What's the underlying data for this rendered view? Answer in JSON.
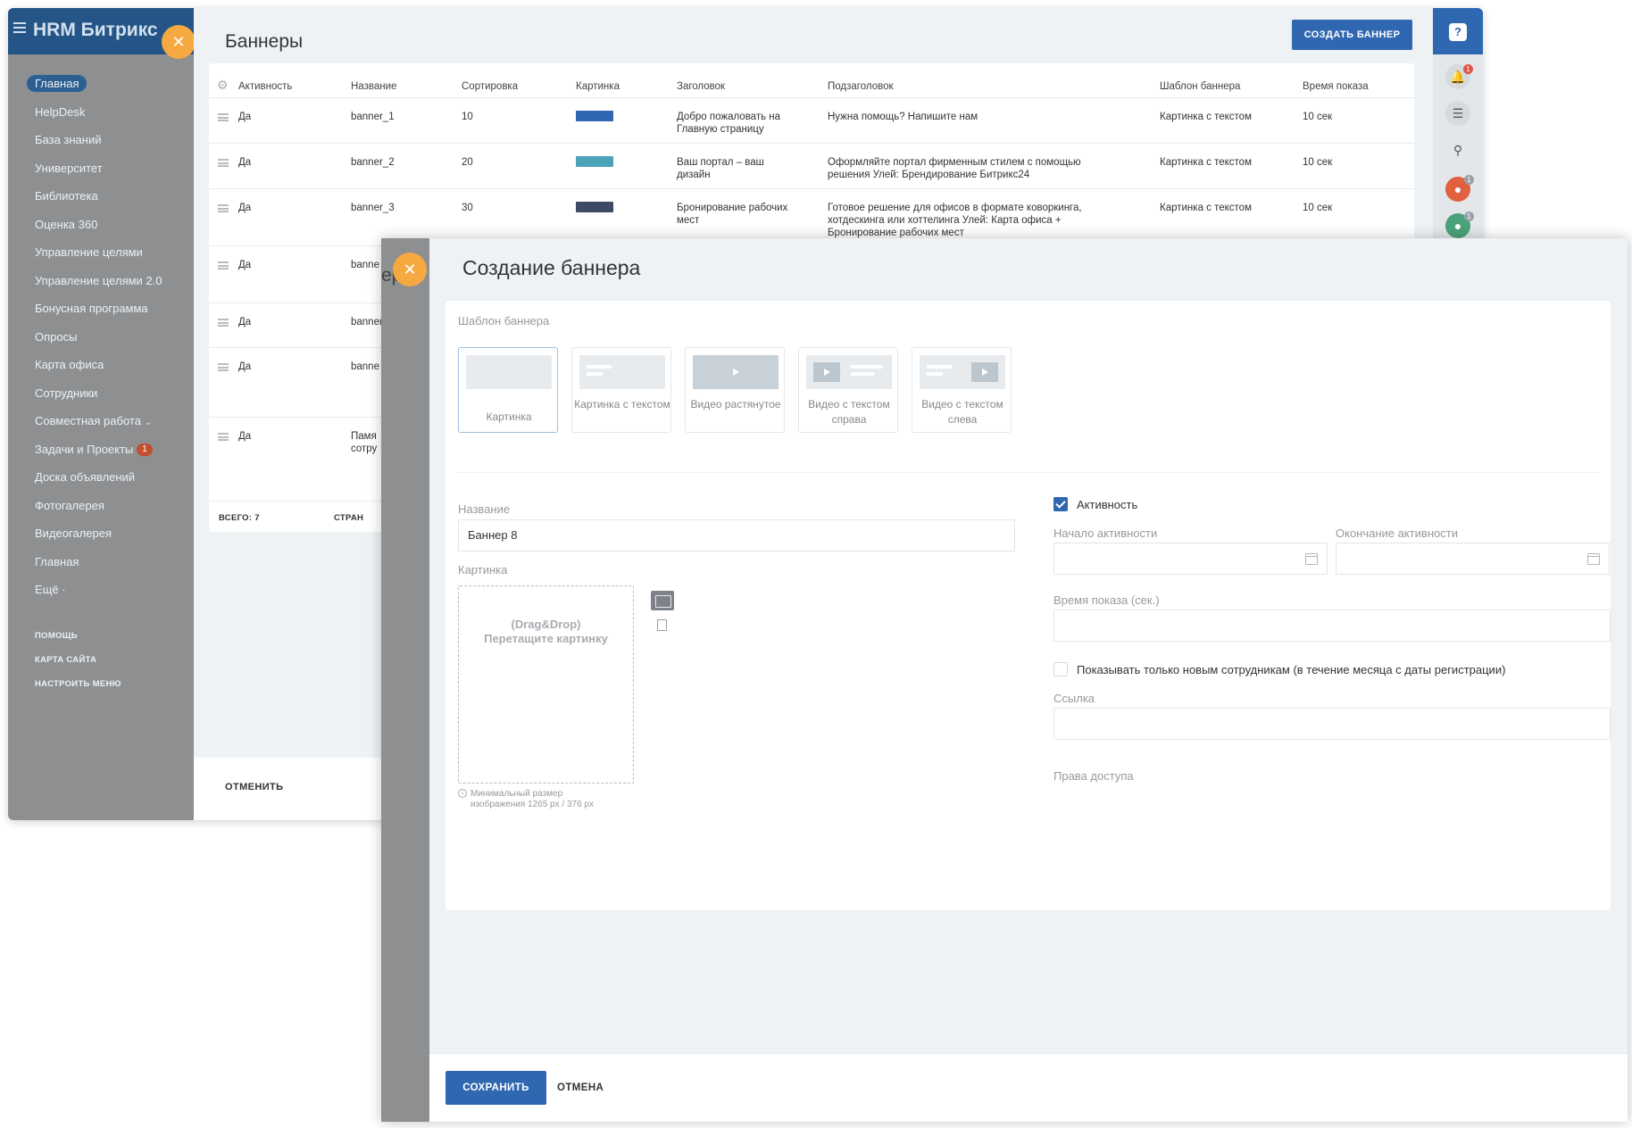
{
  "app": {
    "brand": "HRM Битрикс",
    "close_glyph": "✕"
  },
  "sidebar": {
    "items": [
      {
        "label": "Главная"
      },
      {
        "label": "HelpDesk"
      },
      {
        "label": "База знаний"
      },
      {
        "label": "Университет"
      },
      {
        "label": "Библиотека"
      },
      {
        "label": "Оценка 360"
      },
      {
        "label": "Управление целями"
      },
      {
        "label": "Управление целями 2.0"
      },
      {
        "label": "Бонусная программа"
      },
      {
        "label": "Опросы"
      },
      {
        "label": "Карта офиса"
      },
      {
        "label": "Сотрудники"
      },
      {
        "label": "Совместная работа",
        "chevron": "⌄"
      },
      {
        "label": "Задачи и Проекты",
        "badge": "1"
      },
      {
        "label": "Доска объявлений"
      },
      {
        "label": "Фотогалерея"
      },
      {
        "label": "Видеогалерея"
      },
      {
        "label": "Главная"
      },
      {
        "label": "Ещё ·"
      }
    ],
    "footer_links": [
      "ПОМОЩЬ",
      "КАРТА САЙТА",
      "НАСТРОИТЬ МЕНЮ"
    ]
  },
  "banners_page": {
    "title": "Баннеры",
    "create_button": "СОЗДАТЬ БАННЕР",
    "columns": [
      "Активность",
      "Название",
      "Сортировка",
      "Картинка",
      "Заголовок",
      "Подзаголовок",
      "Шаблон баннера",
      "Время показа"
    ],
    "rows": [
      {
        "active": "Да",
        "name": "banner_1",
        "sort": "10",
        "title": "Добро пожаловать на Главную страницу",
        "subtitle": "Нужна помощь? Напишите нам",
        "template": "Картинка с текстом",
        "time": "10 сек"
      },
      {
        "active": "Да",
        "name": "banner_2",
        "sort": "20",
        "title": "Ваш портал – ваш дизайн",
        "subtitle": "Оформляйте портал фирменным стилем с помощью решения Улей: Брендирование Битрикс24",
        "template": "Картинка с текстом",
        "time": "10 сек"
      },
      {
        "active": "Да",
        "name": "banner_3",
        "sort": "30",
        "title": "Бронирование рабочих мест",
        "subtitle": "Готовое решение для офисов в формате коворкинга, хотдескинга или хоттелинга Улей: Карта офиса + Бронирование рабочих мест",
        "template": "Картинка с текстом",
        "time": "10 сек"
      },
      {
        "active": "Да",
        "name": "banne"
      },
      {
        "active": "Да",
        "name": "bannerсть"
      },
      {
        "active": "Да",
        "name": "banne"
      },
      {
        "active": "Да",
        "name": "Памя сотру"
      }
    ],
    "total_label": "ВСЕГО:",
    "total_value": "7",
    "pages_label": "СТРАН",
    "cancel": "ОТМЕНИТЬ",
    "thumb_colors": [
      "#2f67b1",
      "#4aa3b8",
      "#3e4a63"
    ]
  },
  "right_panel": {
    "help": "?",
    "notif_badge": "1",
    "user_badge": "1",
    "group_badge": "1"
  },
  "dialog": {
    "title": "Создание баннера",
    "template_label": "Шаблон баннера",
    "templates": [
      "Картинка",
      "Картинка с текстом",
      "Видео растянутое",
      "Видео с текстом справа",
      "Видео с текстом слева"
    ],
    "name_label": "Название",
    "name_value": "Баннер 8",
    "picture_label": "Картинка",
    "dropzone_line1": "(Drag&Drop)",
    "dropzone_line2": "Перетащите картинку",
    "hint": "Минимальный размер изображения 1265 px / 376 px",
    "active_label": "Активность",
    "start_label": "Начало активности",
    "end_label": "Окончание активности",
    "time_label": "Время показа (сек.)",
    "new_only_label": "Показывать только новым сотрудникам (в течение месяца с даты регистрации)",
    "link_label": "Ссылка",
    "rights_label": "Права доступа",
    "save": "СОХРАНИТЬ",
    "cancel": "ОТМЕНА",
    "behind_fragment": "ер"
  }
}
